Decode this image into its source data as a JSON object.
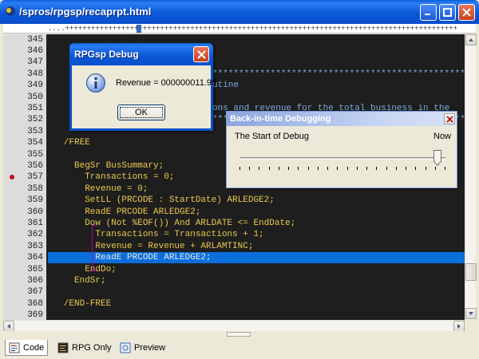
{
  "window": {
    "title": "/spros/rpgsp/recaprpt.html"
  },
  "ruler": {
    "text": "....+++++++++++++++++++++++++++++++++++++++++++++++++++++++++++++++++++++++++++++++++++++++++++"
  },
  "editor": {
    "lines": [
      {
        "num": "345",
        "text": ""
      },
      {
        "num": "346",
        "text": ""
      },
      {
        "num": "347",
        "text": ""
      },
      {
        "num": "348",
        "text": ""
      },
      {
        "num": "349",
        "text": ""
      },
      {
        "num": "350",
        "text": ""
      },
      {
        "num": "351",
        "text": ""
      },
      {
        "num": "352",
        "text": ""
      },
      {
        "num": "353",
        "text": ""
      },
      {
        "num": "354",
        "text": "   /FREE"
      },
      {
        "num": "355",
        "text": ""
      },
      {
        "num": "356",
        "text": "     BegSr BusSummary;"
      },
      {
        "num": "357",
        "text": "       Transactions = 0;"
      },
      {
        "num": "358",
        "text": "       Revenue = 0;"
      },
      {
        "num": "359",
        "text": "       SetLL (PRCODE : StartDate) ARLEDGE2;"
      },
      {
        "num": "360",
        "text": "       ReadE PRCODE ARLEDGE2;"
      },
      {
        "num": "361",
        "text": "       Dow (Not %EOF()) And ARLDATE <= EndDate;"
      },
      {
        "num": "362",
        "text": "         Transactions = Transactions + 1;"
      },
      {
        "num": "363",
        "text": "         Revenue = Revenue + ARLAMTINC;"
      },
      {
        "num": "364",
        "text": "         ReadE PRCODE ARLEDGE2;"
      },
      {
        "num": "365",
        "text": "       EndDo;"
      },
      {
        "num": "366",
        "text": "     EndSr;"
      },
      {
        "num": "367",
        "text": ""
      },
      {
        "num": "368",
        "text": "   /END-FREE"
      },
      {
        "num": "369",
        "text": ""
      }
    ],
    "comment_348": "******************************************************",
    "comment_349": "utine",
    "comment_351": "ons and revenue for the total business in the",
    "comment_352": "***********************************************************"
  },
  "tabs": [
    {
      "label": "Code"
    },
    {
      "label": "RPG Only"
    },
    {
      "label": "Preview"
    }
  ],
  "debug_dialog": {
    "title": "RPGsp Debug",
    "message": "Revenue = 000000011.99",
    "ok_label": "OK"
  },
  "bit_dialog": {
    "title": "Back-in-time Debugging",
    "start_label": "The Start of Debug",
    "now_label": "Now",
    "slider_position": 0.96
  },
  "colors": {
    "code_text": "#eac94d",
    "highlight": "#0a6fdc",
    "comment": "#7aa9dc",
    "titlebar": "#0a58d8"
  }
}
